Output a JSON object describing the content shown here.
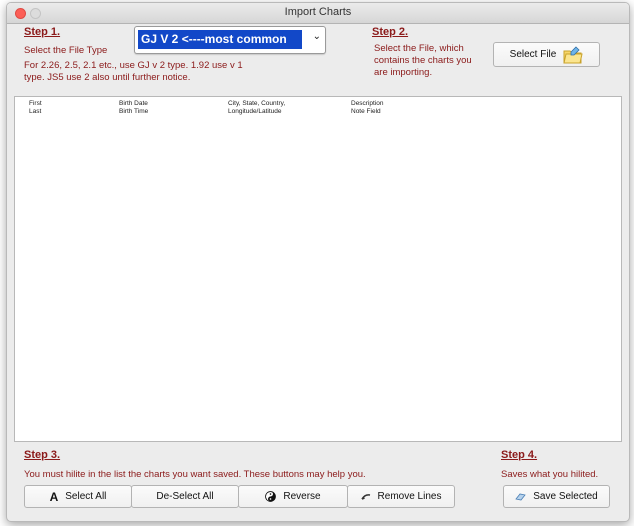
{
  "window": {
    "title": "Import Charts"
  },
  "step1": {
    "heading": "Step 1.",
    "label": "Select the File Type",
    "note_line1": "For 2.26, 2.5, 2.1 etc., use GJ v 2 type. 1.92 use v 1",
    "note_line2": "type. JS5 use 2 also until further notice."
  },
  "file_type_select": {
    "value": "GJ V 2  <----most common",
    "arrow": "⌄"
  },
  "step2": {
    "heading": "Step 2.",
    "note_line1": "Select the File, which",
    "note_line2": "contains the charts you",
    "note_line3": "are importing.",
    "select_file_label": "Select File"
  },
  "list": {
    "columns": [
      {
        "line1": "First",
        "line2": "Last"
      },
      {
        "line1": "Birth Date",
        "line2": "Birth Time"
      },
      {
        "line1": "City, State, Country,",
        "line2": "Longitude/Latitude"
      },
      {
        "line1": "Description",
        "line2": "Note Field"
      }
    ]
  },
  "step3": {
    "heading": "Step 3.",
    "note": "You must hilite in the list the charts you want saved. These buttons may help you.",
    "select_all": "Select All",
    "deselect_all": "De-Select All",
    "reverse": "Reverse",
    "remove_lines": "Remove Lines"
  },
  "step4": {
    "heading": "Step 4.",
    "note": "Saves what you hilited.",
    "save_selected": "Save Selected"
  },
  "colors": {
    "accent_red": "#8b1a1a",
    "select_blue": "#1248c8"
  },
  "icons": [
    "folder-icon",
    "select-all-icon",
    "yin-yang-icon",
    "remove-lines-icon",
    "save-icon"
  ]
}
